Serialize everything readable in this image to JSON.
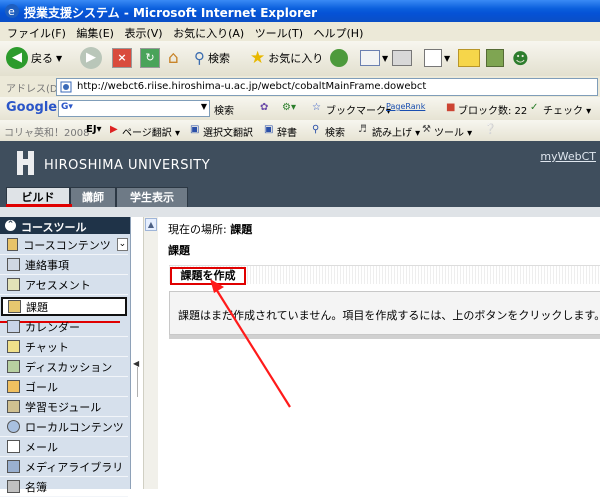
{
  "window": {
    "title": "授業支援システム - Microsoft Internet Explorer"
  },
  "menu": [
    "ファイル(F)",
    "編集(E)",
    "表示(V)",
    "お気に入り(A)",
    "ツール(T)",
    "ヘルプ(H)"
  ],
  "toolbar": {
    "back_label": "戻る",
    "search_label": "検索",
    "favorites_label": "お気に入り"
  },
  "address": {
    "label": "アドレス(D)",
    "url": "http://webct6.riise.hiroshima-u.ac.jp/webct/cobaltMainFrame.dowebct"
  },
  "googlebar": {
    "logo": "Google",
    "search_label": "検索",
    "bookmarks_label": "ブックマーク▾",
    "pagerank_label": "PageRank",
    "blocked_label": "ブロック数: 22",
    "check_label": "チェック ▾"
  },
  "dictbar": {
    "item0": "コリャ英和！2008",
    "item1": "EJ▾",
    "item2": "ページ翻訳 ▾",
    "item3": "選択文翻訳",
    "item4": "辞書",
    "item5": "検索",
    "item6": "読み上げ ▾",
    "item7": "ツール ▾"
  },
  "header": {
    "university": "HIROSHIMA UNIVERSITY",
    "mywebct": "myWebCT"
  },
  "tabs": [
    "ビルド",
    "講師",
    "学生表示"
  ],
  "sidebar": {
    "section_title": "コースツール",
    "items": [
      "コースコンテンツ",
      "連絡事項",
      "アセスメント",
      "課題",
      "カレンダー",
      "チャット",
      "ディスカッション",
      "ゴール",
      "学習モジュール",
      "ローカルコンテンツ",
      "メール",
      "メディアライブラリ",
      "名簿"
    ]
  },
  "main": {
    "breadcrumb_label": "現在の場所:",
    "breadcrumb_value": "課題",
    "page_title": "課題",
    "create_button": "課題を作成",
    "message": "課題はまだ作成されていません。項目を作成するには、上のボタンをクリックします。"
  }
}
